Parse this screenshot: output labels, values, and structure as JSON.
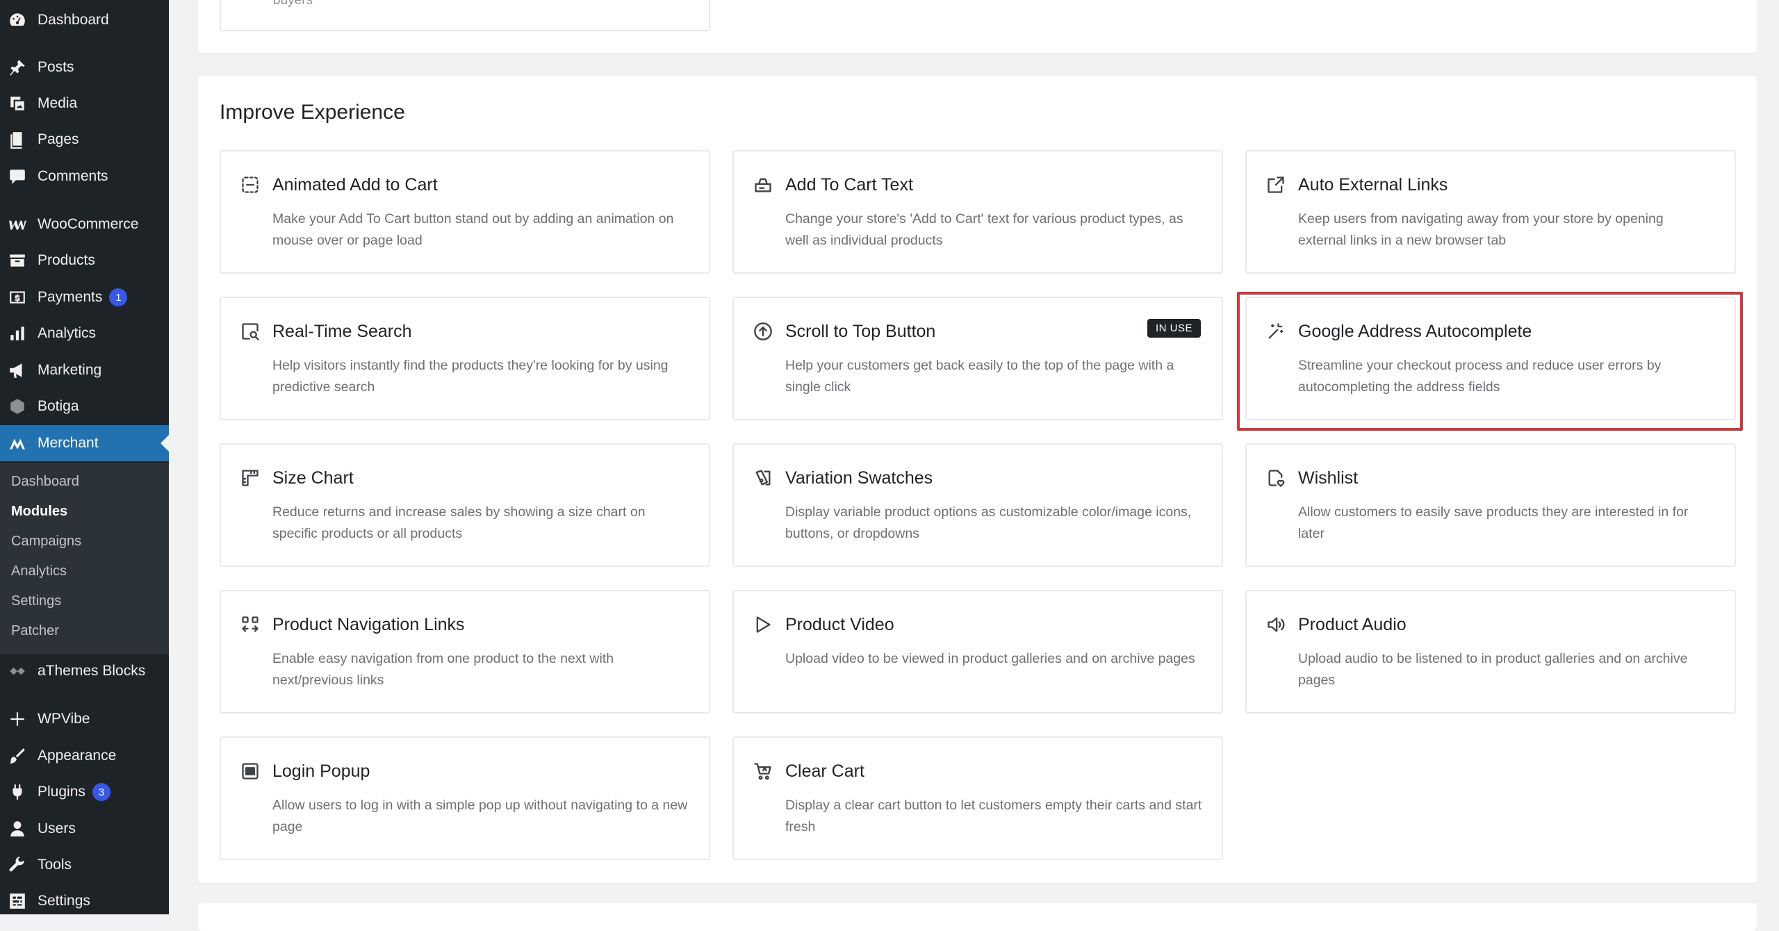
{
  "sidebar": {
    "items": [
      {
        "label": "Dashboard",
        "icon": "dashboard-icon"
      },
      {
        "label": "Posts",
        "icon": "pin-icon"
      },
      {
        "label": "Media",
        "icon": "media-icon"
      },
      {
        "label": "Pages",
        "icon": "pages-icon"
      },
      {
        "label": "Comments",
        "icon": "comments-icon"
      },
      {
        "label": "WooCommerce",
        "icon": "woocommerce-icon"
      },
      {
        "label": "Products",
        "icon": "products-icon"
      },
      {
        "label": "Payments",
        "icon": "payments-icon",
        "badge": "1"
      },
      {
        "label": "Analytics",
        "icon": "analytics-icon"
      },
      {
        "label": "Marketing",
        "icon": "megaphone-icon"
      },
      {
        "label": "Botiga",
        "icon": "botiga-icon"
      },
      {
        "label": "Merchant",
        "icon": "merchant-icon"
      },
      {
        "label": "aThemes Blocks",
        "icon": "athemes-icon"
      },
      {
        "label": "WPVibe",
        "icon": "sparkle-icon"
      },
      {
        "label": "Appearance",
        "icon": "brush-icon"
      },
      {
        "label": "Plugins",
        "icon": "plug-icon",
        "badge": "3"
      },
      {
        "label": "Users",
        "icon": "users-icon"
      },
      {
        "label": "Tools",
        "icon": "wrench-icon"
      },
      {
        "label": "Settings",
        "icon": "settings-icon"
      }
    ],
    "submenu": [
      "Dashboard",
      "Modules",
      "Campaigns",
      "Analytics",
      "Settings",
      "Patcher"
    ]
  },
  "prev_section": {
    "card_tail": "buyers"
  },
  "section": {
    "title": "Improve Experience",
    "in_use_label": "IN USE",
    "cards": [
      {
        "title": "Animated Add to Cart",
        "desc": "Make your Add To Cart button stand out by adding an animation on mouse over or page load",
        "icon": "animated-cart-icon"
      },
      {
        "title": "Add To Cart Text",
        "desc": "Change your store's 'Add to Cart' text for various product types, as well as individual products",
        "icon": "cart-text-icon"
      },
      {
        "title": "Auto External Links",
        "desc": "Keep users from navigating away from your store by opening external links in a new browser tab",
        "icon": "external-link-icon"
      },
      {
        "title": "Real-Time Search",
        "desc": "Help visitors instantly find the products they're looking for by using predictive search",
        "icon": "search-icon"
      },
      {
        "title": "Scroll to Top Button",
        "desc": "Help your customers get back easily to the top of the page with a single click",
        "icon": "arrow-up-circle-icon"
      },
      {
        "title": "Google Address Autocomplete",
        "desc": "Streamline your checkout process and reduce user errors by autocompleting the address fields",
        "icon": "magic-wand-icon"
      },
      {
        "title": "Size Chart",
        "desc": "Reduce returns and increase sales by showing a size chart on specific products or all products",
        "icon": "ruler-icon"
      },
      {
        "title": "Variation Swatches",
        "desc": "Display variable product options as customizable color/image icons, buttons, or dropdowns",
        "icon": "swatches-icon"
      },
      {
        "title": "Wishlist",
        "desc": "Allow customers to easily save products they are interested in for later",
        "icon": "wishlist-icon"
      },
      {
        "title": "Product Navigation Links",
        "desc": "Enable easy navigation from one product to the next with next/previous links",
        "icon": "navigation-icon"
      },
      {
        "title": "Product Video",
        "desc": "Upload video to be viewed in product galleries and on archive pages",
        "icon": "play-icon"
      },
      {
        "title": "Product Audio",
        "desc": "Upload audio to be listened to in product galleries and on archive pages",
        "icon": "speaker-icon"
      },
      {
        "title": "Login Popup",
        "desc": "Allow users to log in with a simple pop up without navigating to a new page",
        "icon": "login-popup-icon"
      },
      {
        "title": "Clear Cart",
        "desc": "Display a clear cart button to let customers empty their carts and start fresh",
        "icon": "clear-cart-icon"
      }
    ]
  }
}
